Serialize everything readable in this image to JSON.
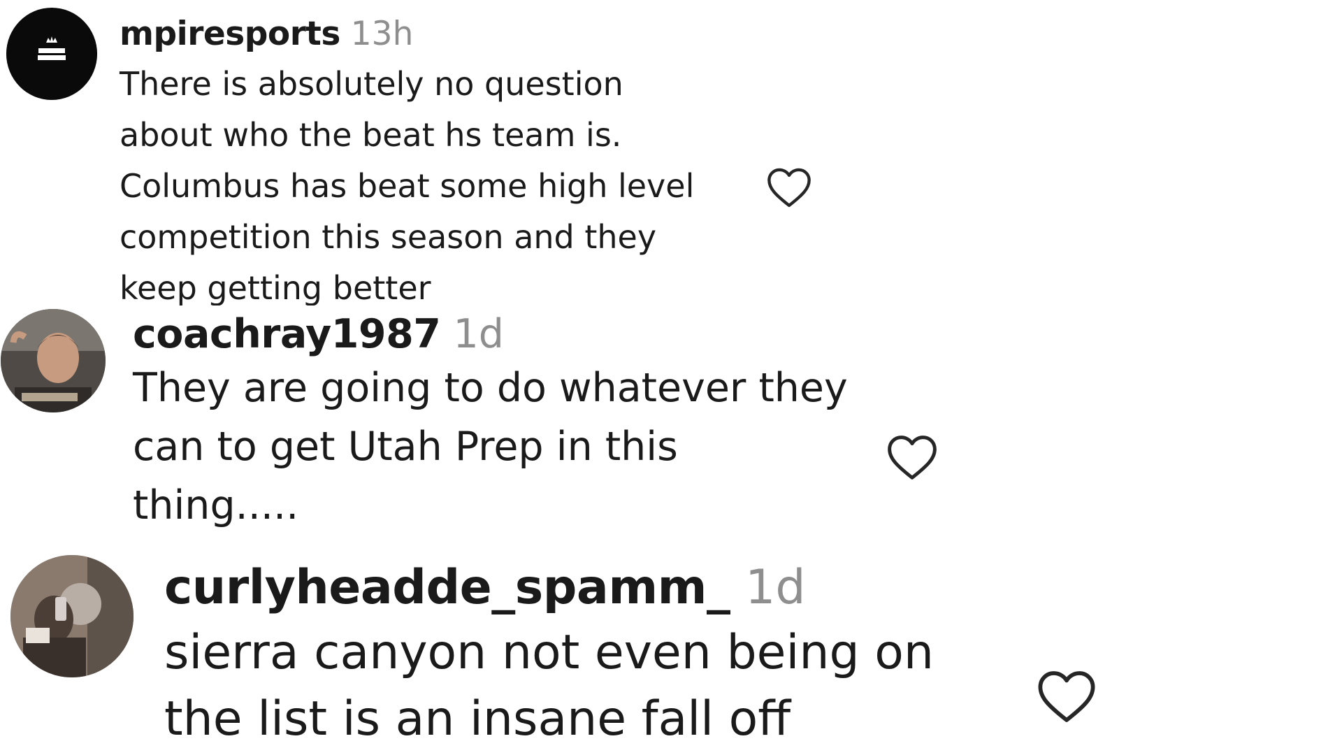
{
  "comments": [
    {
      "username": "mpiresports",
      "time": "13h",
      "avatar_text": [
        "MPIRE",
        "SPORTS"
      ],
      "lines": [
        "There is absolutely no question",
        "about who the beat hs team is.",
        "Columbus has beat some high level",
        "competition this season and they",
        "keep getting better"
      ],
      "like_icon": "heart-outline-icon"
    },
    {
      "username": "coachray1987",
      "time": "1d",
      "lines": [
        "They are going to do whatever they",
        "can to get Utah Prep in this",
        "thing....."
      ],
      "like_icon": "heart-outline-icon"
    },
    {
      "username": "curlyheadde_spamm_",
      "time": "1d",
      "lines": [
        "sierra canyon not even being on",
        "the list is an insane fall off"
      ],
      "like_icon": "heart-outline-icon"
    }
  ],
  "colors": {
    "text": "#1a1a1a",
    "timestamp": "#8e8e8e",
    "background": "#ffffff"
  }
}
